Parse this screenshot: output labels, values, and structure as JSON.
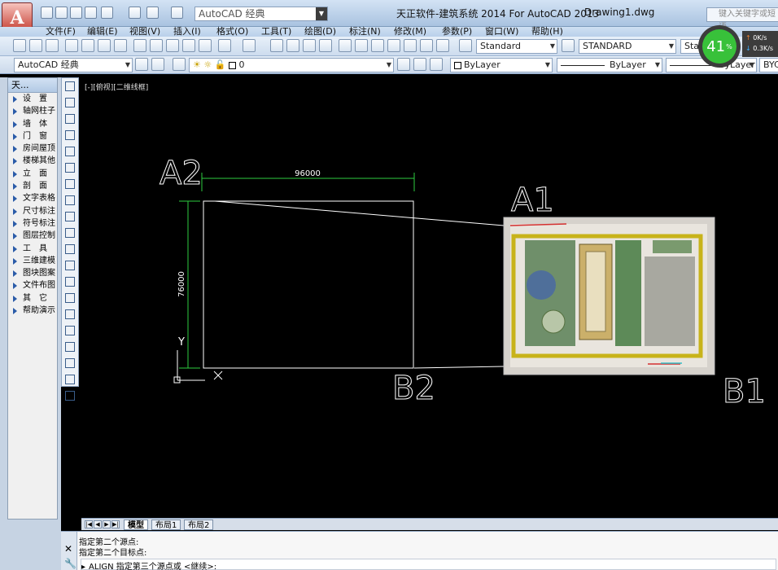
{
  "titlebar": {
    "app_logo_letter": "A",
    "workspace": "AutoCAD 经典",
    "title": "天正软件-建筑系统 2014  For AutoCAD 2013",
    "drawing_name": "Drawing1.dwg",
    "search_placeholder": "键入关键字或短语"
  },
  "menu": [
    "文件(F)",
    "编辑(E)",
    "视图(V)",
    "插入(I)",
    "格式(O)",
    "工具(T)",
    "绘图(D)",
    "标注(N)",
    "修改(M)",
    "参数(P)",
    "窗口(W)",
    "帮助(H)"
  ],
  "toolbar1": {
    "text_style": "Standard",
    "dim_style": "STANDARD",
    "table_style": "Standard"
  },
  "toolbar2": {
    "workspace_combo": "AutoCAD 经典",
    "layer": "0",
    "color": "ByLayer",
    "linetype": "ByLayer",
    "lineweight": "ByLayer",
    "plotstyle": "BYC"
  },
  "perf_widget": {
    "percent": "41",
    "unit": "%",
    "upload": "0K/s",
    "download": "0.3K/s"
  },
  "tianzheng": {
    "header": "天...",
    "items": [
      "设　置",
      "轴网柱子",
      "墙　体",
      "门　窗",
      "房间屋顶",
      "楼梯其他",
      "立　面",
      "剖　面",
      "文字表格",
      "尺寸标注",
      "符号标注",
      "图层控制",
      "工　具",
      "三维建模",
      "图块图案",
      "文件布图",
      "其　它",
      "帮助演示"
    ]
  },
  "viewport": {
    "label": "[-][俯视][二维线框]"
  },
  "drawing": {
    "dim_width": "96000",
    "dim_height": "76000",
    "label_a2": "A2",
    "label_a1": "A1",
    "label_b2": "B2",
    "label_b1": "B1",
    "ucs_y": "Y",
    "ucs_x": "X"
  },
  "tabs": [
    "模型",
    "布局1",
    "布局2"
  ],
  "command": {
    "line1": "指定第二个源点:",
    "line2": "指定第二个目标点:",
    "prompt": "ALIGN 指定第三个源点或 <继续>:"
  },
  "colors": {
    "dim": "#2ecc40",
    "geometry": "#ffffff",
    "canvas": "#000000",
    "accent": "#c0392b"
  }
}
